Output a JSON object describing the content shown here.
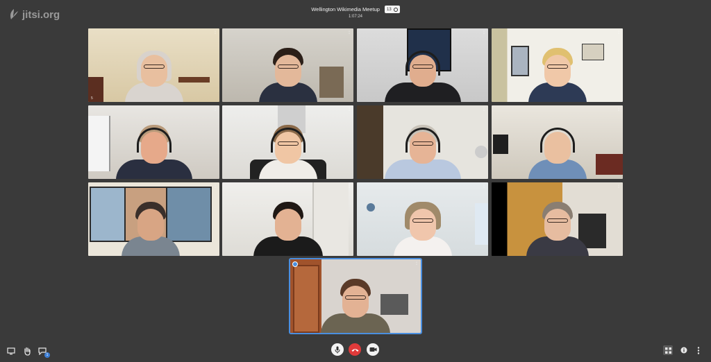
{
  "app": {
    "logo_text": "jitsi.org"
  },
  "meeting": {
    "title": "Wellington Wikimedia Meetup",
    "participant_count": "13",
    "duration": "1:07:24"
  },
  "colors": {
    "background": "#3a3a3a",
    "accent": "#4a8fe0",
    "hangup": "#e03a3a"
  },
  "participants": [
    {
      "index_label": "5"
    },
    {
      "index_label": ""
    },
    {
      "index_label": ""
    },
    {
      "index_label": ""
    },
    {
      "index_label": ""
    },
    {
      "index_label": ""
    },
    {
      "index_label": ""
    },
    {
      "index_label": ""
    },
    {
      "index_label": ""
    },
    {
      "index_label": ""
    },
    {
      "index_label": ""
    },
    {
      "index_label": ""
    },
    {
      "index_label": ""
    }
  ],
  "toolbar": {
    "icons": [
      "screen-share-icon",
      "raise-hand-icon",
      "chat-icon",
      "microphone-icon",
      "hangup-icon",
      "camera-icon",
      "tile-view-icon",
      "info-icon",
      "more-options-icon"
    ],
    "chat_unread": "1"
  }
}
